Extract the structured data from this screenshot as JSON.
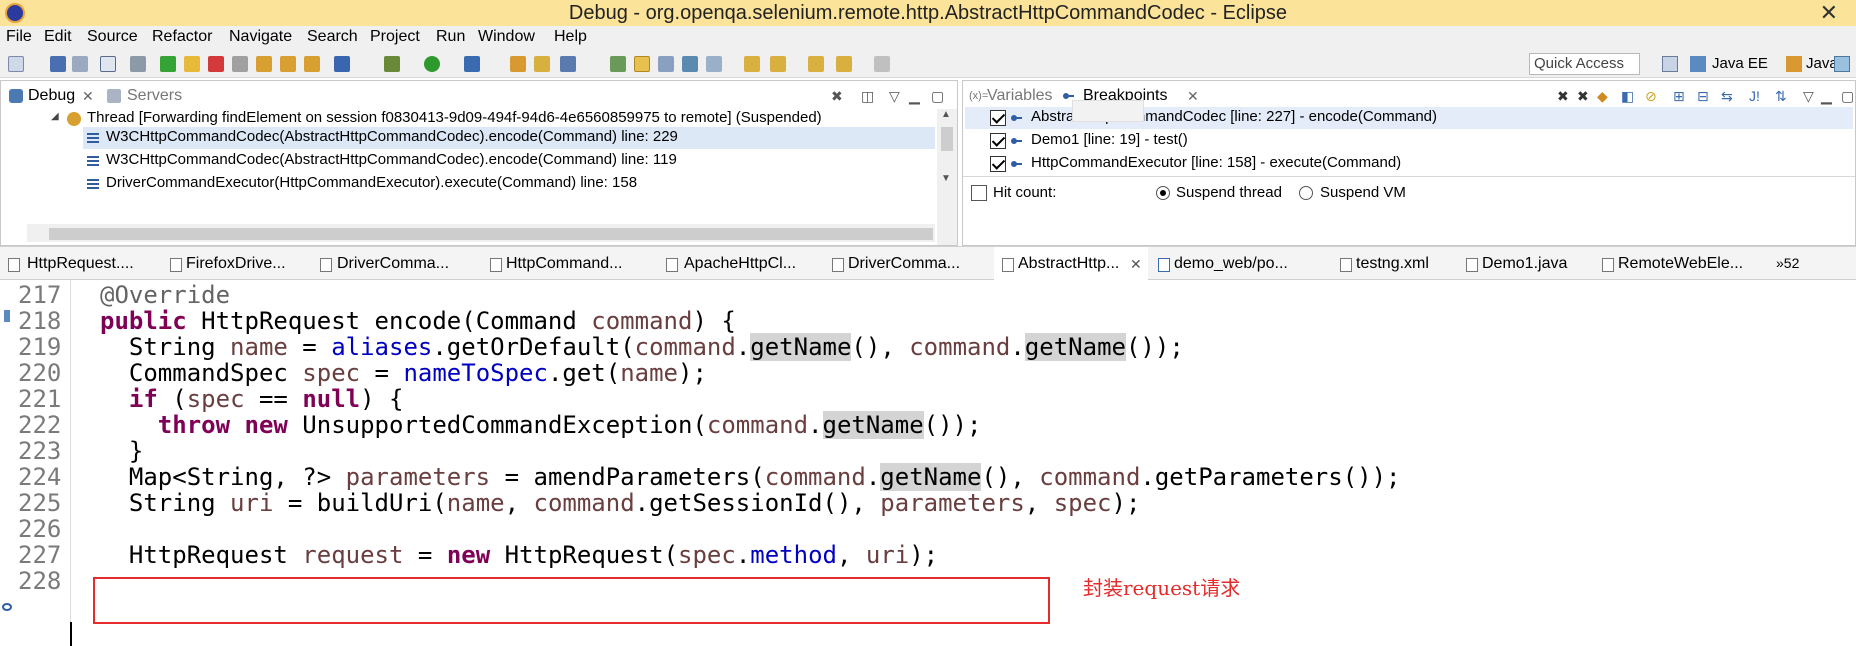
{
  "window": {
    "title": "Debug - org.openqa.selenium.remote.http.AbstractHttpCommandCodec - Eclipse"
  },
  "menu": [
    "File",
    "Edit",
    "Source",
    "Refactor",
    "Navigate",
    "Search",
    "Project",
    "Run",
    "Window",
    "Help"
  ],
  "toolbar": {
    "quick_access": "Quick Access",
    "perspectives": [
      "Java EE",
      "Java"
    ]
  },
  "debug_view": {
    "tabs": [
      "Debug",
      "Servers"
    ],
    "thread": "Thread [Forwarding findElement on session f0830413-9d09-494f-94d6-4e6560859975 to remote] (Suspended)",
    "frames": [
      "W3CHttpCommandCodec(AbstractHttpCommandCodec).encode(Command) line: 229",
      "W3CHttpCommandCodec(AbstractHttpCommandCodec).encode(Command) line: 119",
      "DriverCommandExecutor(HttpCommandExecutor).execute(Command) line: 158"
    ]
  },
  "breakpoints_view": {
    "tabs": [
      "Variables",
      "Breakpoints"
    ],
    "items": [
      "AbstractHttpCommandCodec [line: 227] - encode(Command)",
      "Demo1 [line: 19] - test()",
      "HttpCommandExecutor [line: 158] - execute(Command)"
    ],
    "hit_count_label": "Hit count:",
    "suspend_thread": "Suspend thread",
    "suspend_vm": "Suspend VM"
  },
  "editor_tabs": [
    "HttpRequest....",
    "FirefoxDrive...",
    "DriverComma...",
    "HttpCommand...",
    "ApacheHttpCl...",
    "DriverComma...",
    "AbstractHttp...",
    "demo_web/po...",
    "testng.xml",
    "Demo1.java",
    "RemoteWebEle..."
  ],
  "editor_tabs_overflow": "»52",
  "editor": {
    "line_numbers": [
      "217",
      "218",
      "219",
      "220",
      "221",
      "222",
      "223",
      "224",
      "225",
      "226",
      "227",
      "228"
    ]
  },
  "annotation": {
    "text": "封装request请求",
    "color": "#e52b2b"
  },
  "colors": {
    "titlebar": "#fbe49a",
    "keyword": "#7f0055",
    "field": "#0000c0",
    "variable": "#6a3e3e"
  }
}
